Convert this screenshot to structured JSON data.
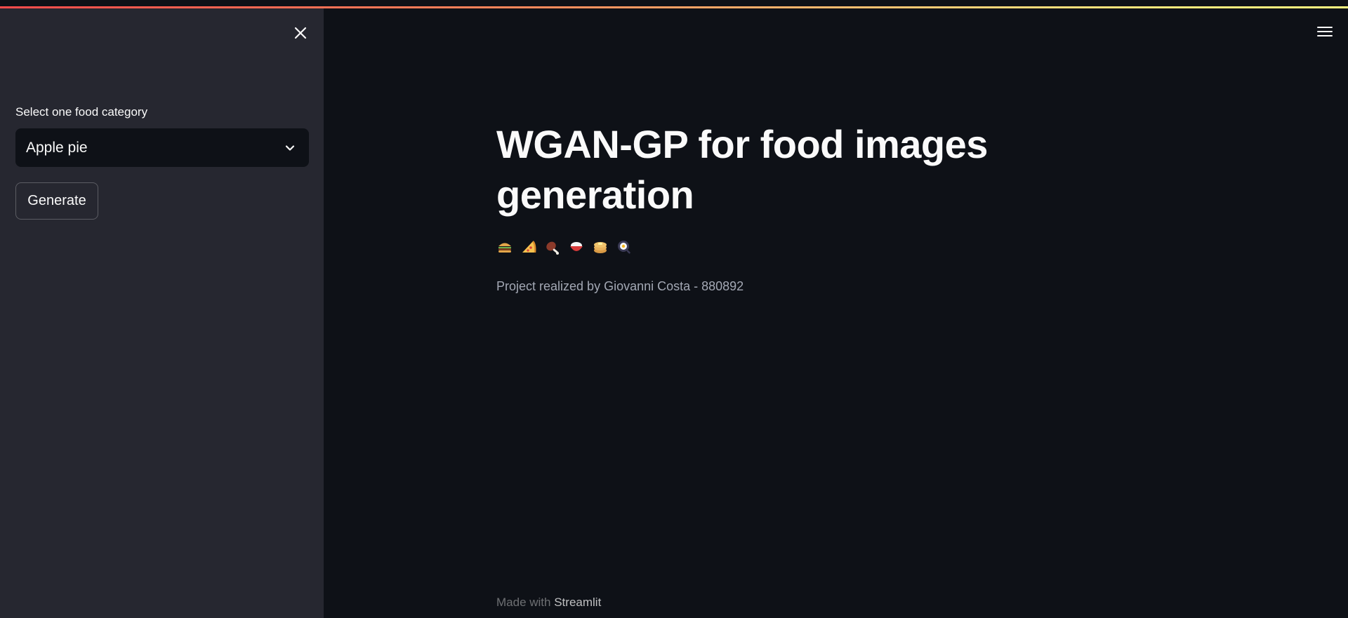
{
  "sidebar": {
    "select_label": "Select one food category",
    "select_value": "Apple pie",
    "generate_label": "Generate"
  },
  "main": {
    "title": "WGAN-GP for food images generation",
    "emojis": [
      "hamburger-icon",
      "pizza-icon",
      "meat-on-bone-icon",
      "rice-bowl-icon",
      "pancakes-icon",
      "fried-egg-pan-icon"
    ],
    "credit": "Project realized by Giovanni Costa - 880892"
  },
  "footer": {
    "prefix": "Made with",
    "link": "Streamlit"
  },
  "colors": {
    "background": "#0e1117",
    "sidebar": "#262730",
    "text": "#fafafa",
    "accent_gradient": [
      "#ff4b4b",
      "#fffd80"
    ]
  }
}
